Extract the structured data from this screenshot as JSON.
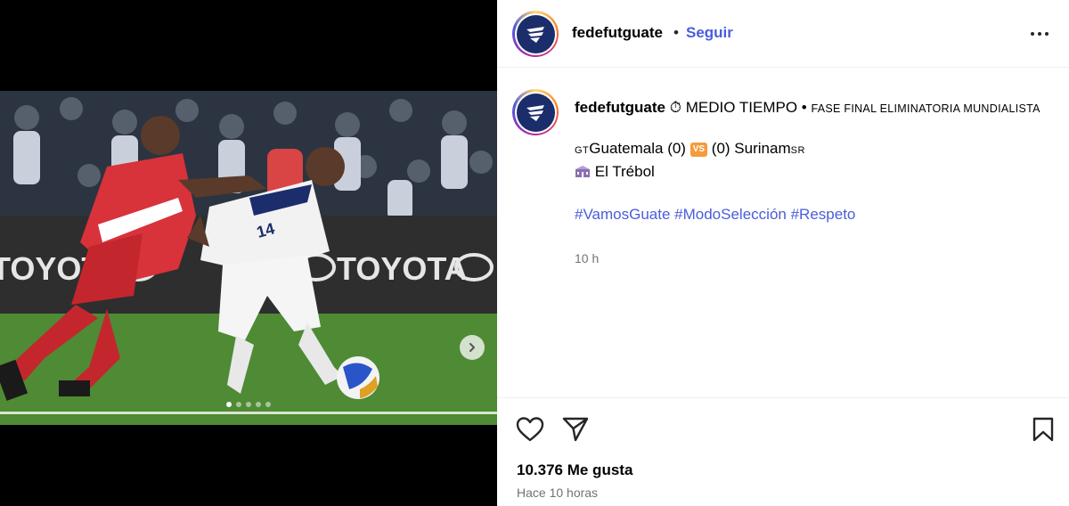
{
  "media": {
    "carousel_dots": 5,
    "active_dot": 0,
    "next_icon": "chevron-right-icon",
    "ad_board_text": "TOYOTA"
  },
  "header": {
    "username": "fedefutguate",
    "separator": "•",
    "follow_label": "Seguir",
    "more_icon": "more-options-icon"
  },
  "caption": {
    "username": "fedefutguate",
    "timer_emoji": "⏱",
    "status": "MEDIO TIEMPO",
    "bullet": "•",
    "phase": "FASE FINAL ELIMINATORIA MUNDIALISTA",
    "home_flag": "GT",
    "home_team": "Guatemala",
    "home_score": "(0)",
    "vs": "VS",
    "away_score": "(0)",
    "away_team": "Surinam",
    "away_flag": "SR",
    "stadium": "El Trébol",
    "hashtags": [
      "#VamosGuate",
      "#ModoSelección",
      "#Respeto"
    ],
    "time_ago": "10 h"
  },
  "actions": {
    "like_icon": "heart-icon",
    "share_icon": "send-icon",
    "save_icon": "bookmark-icon"
  },
  "footer": {
    "likes": "10.376 Me gusta",
    "posted": "Hace 10 horas"
  },
  "colors": {
    "link": "#4a5ddb",
    "secondary_text": "#737373",
    "brand_navy": "#1b2d6b",
    "vs_badge": "#f59a3d"
  }
}
